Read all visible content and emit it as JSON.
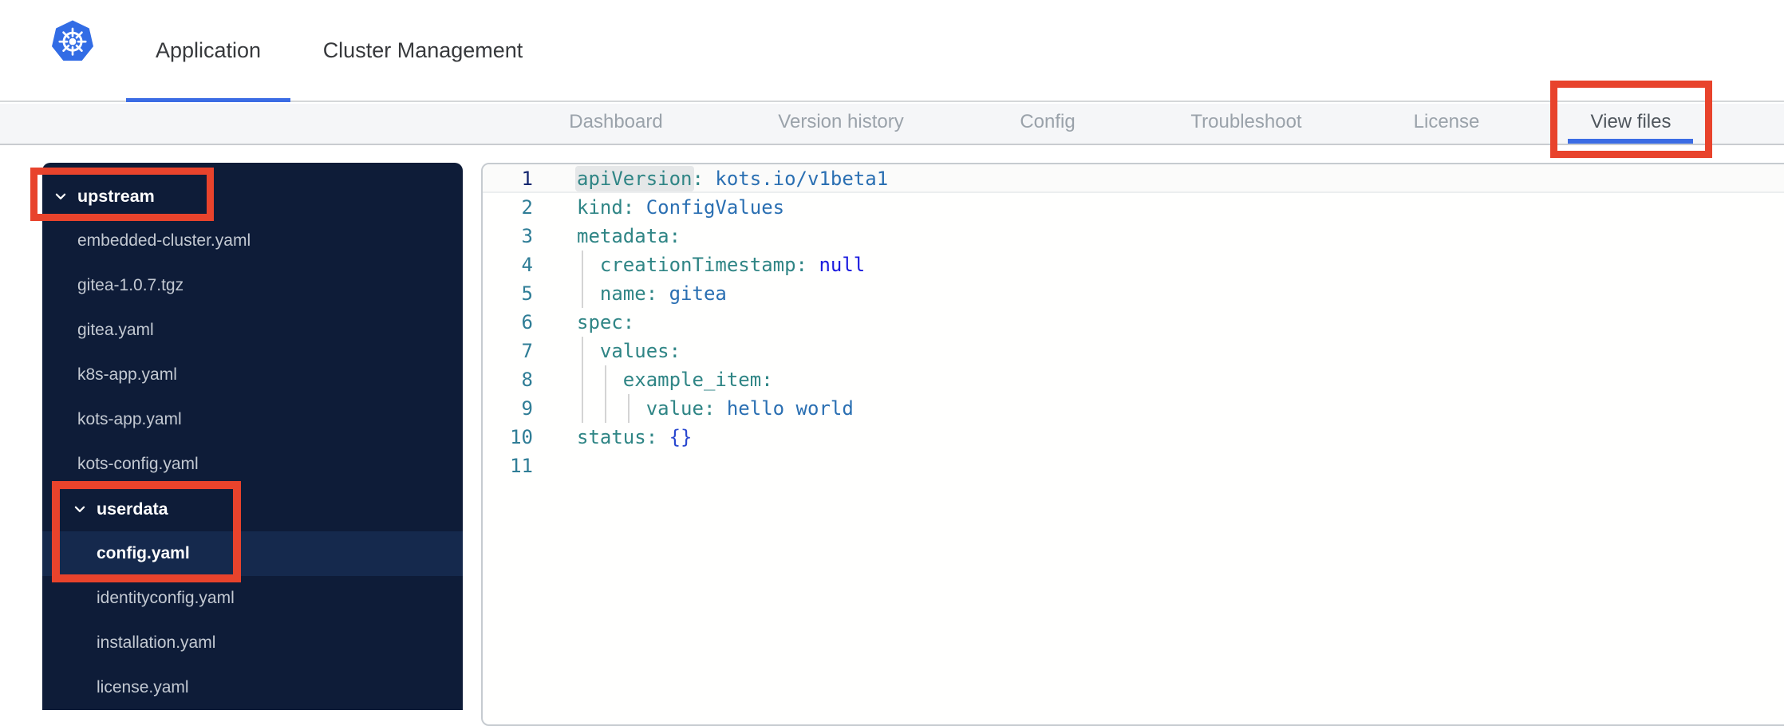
{
  "header": {
    "logo_icon": "kubernetes-helm-icon",
    "tabs": [
      {
        "label": "Application",
        "active": true
      },
      {
        "label": "Cluster Management",
        "active": false
      }
    ]
  },
  "nav": {
    "items": [
      {
        "label": "Dashboard",
        "active": false
      },
      {
        "label": "Version history",
        "active": false
      },
      {
        "label": "Config",
        "active": false
      },
      {
        "label": "Troubleshoot",
        "active": false
      },
      {
        "label": "License",
        "active": false
      },
      {
        "label": "View files",
        "active": true
      }
    ]
  },
  "file_tree": {
    "items": [
      {
        "type": "folder",
        "label": "upstream",
        "depth": 0,
        "expanded": true,
        "icon": "chevron-down-icon"
      },
      {
        "type": "file",
        "label": "embedded-cluster.yaml",
        "depth": 1
      },
      {
        "type": "file",
        "label": "gitea-1.0.7.tgz",
        "depth": 1
      },
      {
        "type": "file",
        "label": "gitea.yaml",
        "depth": 1
      },
      {
        "type": "file",
        "label": "k8s-app.yaml",
        "depth": 1
      },
      {
        "type": "file",
        "label": "kots-app.yaml",
        "depth": 1
      },
      {
        "type": "file",
        "label": "kots-config.yaml",
        "depth": 1
      },
      {
        "type": "folder",
        "label": "userdata",
        "depth": 1,
        "expanded": true,
        "icon": "chevron-down-icon"
      },
      {
        "type": "file",
        "label": "config.yaml",
        "depth": 2,
        "selected": true
      },
      {
        "type": "file",
        "label": "identityconfig.yaml",
        "depth": 2
      },
      {
        "type": "file",
        "label": "installation.yaml",
        "depth": 2
      },
      {
        "type": "file",
        "label": "license.yaml",
        "depth": 2
      }
    ]
  },
  "file_view": {
    "active_line": 1,
    "lines": [
      {
        "n": 1,
        "tokens": [
          [
            "key-hl",
            "apiVersion"
          ],
          [
            "key",
            ":"
          ],
          [
            "plain",
            " "
          ],
          [
            "val",
            "kots.io/v1beta1"
          ]
        ]
      },
      {
        "n": 2,
        "tokens": [
          [
            "key",
            "kind"
          ],
          [
            "key",
            ":"
          ],
          [
            "plain",
            " "
          ],
          [
            "val",
            "ConfigValues"
          ]
        ]
      },
      {
        "n": 3,
        "tokens": [
          [
            "key",
            "metadata"
          ],
          [
            "key",
            ":"
          ]
        ]
      },
      {
        "n": 4,
        "tokens": [
          [
            "plain",
            "  "
          ],
          [
            "key",
            "creationTimestamp"
          ],
          [
            "key",
            ":"
          ],
          [
            "plain",
            " "
          ],
          [
            "null",
            "null"
          ]
        ]
      },
      {
        "n": 5,
        "tokens": [
          [
            "plain",
            "  "
          ],
          [
            "key",
            "name"
          ],
          [
            "key",
            ":"
          ],
          [
            "plain",
            " "
          ],
          [
            "val",
            "gitea"
          ]
        ]
      },
      {
        "n": 6,
        "tokens": [
          [
            "key",
            "spec"
          ],
          [
            "key",
            ":"
          ]
        ]
      },
      {
        "n": 7,
        "tokens": [
          [
            "plain",
            "  "
          ],
          [
            "key",
            "values"
          ],
          [
            "key",
            ":"
          ]
        ]
      },
      {
        "n": 8,
        "tokens": [
          [
            "plain",
            "    "
          ],
          [
            "key",
            "example_item"
          ],
          [
            "key",
            ":"
          ]
        ]
      },
      {
        "n": 9,
        "tokens": [
          [
            "plain",
            "      "
          ],
          [
            "key",
            "value"
          ],
          [
            "key",
            ":"
          ],
          [
            "plain",
            " "
          ],
          [
            "val",
            "hello world"
          ]
        ]
      },
      {
        "n": 10,
        "tokens": [
          [
            "key",
            "status"
          ],
          [
            "key",
            ":"
          ],
          [
            "plain",
            " "
          ],
          [
            "bracket",
            "{}"
          ]
        ]
      },
      {
        "n": 11,
        "tokens": []
      }
    ]
  },
  "annotations": [
    {
      "target": "nav-item-view-files"
    },
    {
      "target": "tree-row-upstream"
    },
    {
      "target": "tree-rows-userdata-and-config-yaml"
    }
  ],
  "colors": {
    "kubernetes_blue": "#326ce5",
    "accent_blue": "#3b6ce4",
    "annotation_red": "#e8432c",
    "nav_bg": "#f5f6f8",
    "sidebar_bg": "#0e1c38",
    "sidebar_selected_bg": "#15294d",
    "yaml_key": "#2f8585",
    "yaml_value": "#2a6fb2",
    "yaml_null": "#1b1bdf",
    "yaml_bracket": "#2948cf",
    "line_number": "#2f7d96",
    "active_line_number": "#13266f"
  }
}
